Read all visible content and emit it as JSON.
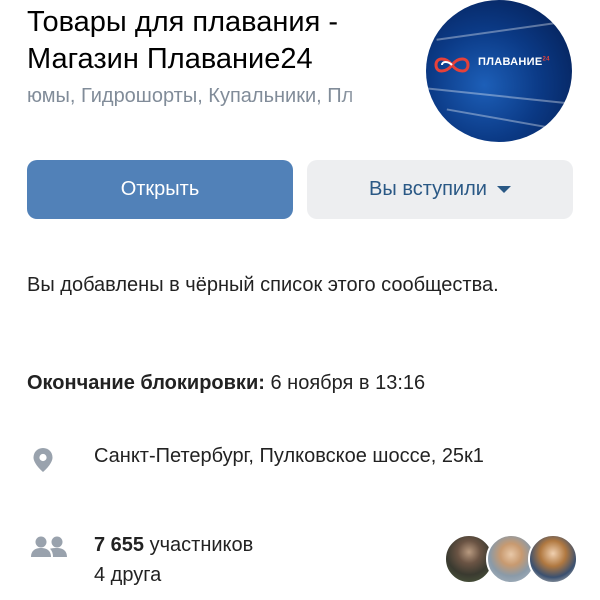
{
  "group": {
    "title": "Товары для плавания - Магазин Плавание24",
    "subtitle": "юмы, Гидрошорты, Купальники, Пл",
    "avatar_logo_text": "ПЛАВАНИЕ",
    "avatar_logo_sup": "24"
  },
  "actions": {
    "open_label": "Открыть",
    "joined_label": "Вы вступили"
  },
  "notice": {
    "blacklist_text": "Вы добавлены в чёрный список этого сообщества.",
    "block_end_label": "Окончание блокировки:",
    "block_end_value": "6 ноября в 13:16"
  },
  "info": {
    "address": "Санкт-Петербург, Пулковское шоссе, 25к1",
    "members_count": "7 655",
    "members_label": "участников",
    "friends": "4 друга"
  },
  "colors": {
    "accent": "#5181b8",
    "secondary_button_bg": "#edeef0",
    "secondary_button_text": "#2a5885",
    "muted_text": "#818c99",
    "icon": "#99a2ad"
  },
  "icons": {
    "location": "location-pin-icon",
    "members": "users-icon",
    "dropdown": "chevron-down-icon"
  }
}
